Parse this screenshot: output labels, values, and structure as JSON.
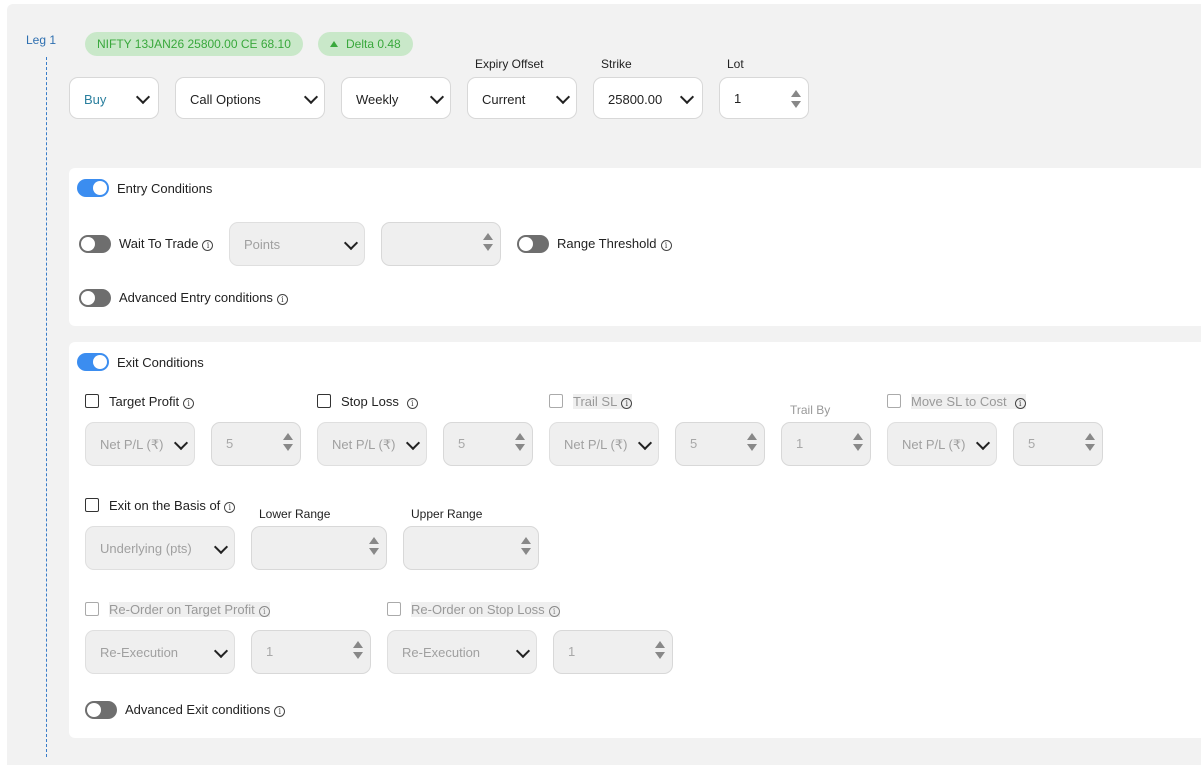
{
  "leg": {
    "label": "Leg 1"
  },
  "pills": {
    "instrument": "NIFTY 13JAN26 25800.00 CE 68.10",
    "delta": "Delta 0.48"
  },
  "top_row": {
    "side": "Buy",
    "option_type": "Call Options",
    "expiry": "Weekly",
    "expiry_offset_label": "Expiry Offset",
    "expiry_offset": "Current",
    "strike_label": "Strike",
    "strike": "25800.00",
    "lot_label": "Lot",
    "lot": "1"
  },
  "entry": {
    "title": "Entry Conditions",
    "wait_to_trade": "Wait To Trade",
    "wait_unit": "Points",
    "wait_value": "",
    "range_threshold": "Range Threshold",
    "advanced": "Advanced Entry conditions"
  },
  "exit": {
    "title": "Exit Conditions",
    "target_profit": {
      "label": "Target Profit",
      "unit": "Net P/L (₹)",
      "value": "5"
    },
    "stop_loss": {
      "label": "Stop Loss",
      "unit": "Net P/L (₹)",
      "value": "5"
    },
    "trail_sl": {
      "label": "Trail SL",
      "unit": "Net P/L (₹)",
      "value": "5",
      "trail_by_label": "Trail By",
      "trail_by": "1"
    },
    "move_sl": {
      "label": "Move SL to Cost",
      "unit": "Net P/L (₹)",
      "value": "5"
    },
    "basis": {
      "label": "Exit on the Basis of",
      "unit": "Underlying (pts)",
      "lower_label": "Lower Range",
      "upper_label": "Upper Range",
      "lower": "",
      "upper": ""
    },
    "reorder_target": {
      "label": "Re-Order on Target Profit",
      "mode": "Re-Execution",
      "value": "1"
    },
    "reorder_stop": {
      "label": "Re-Order on Stop Loss",
      "mode": "Re-Execution",
      "value": "1"
    },
    "advanced": "Advanced Exit conditions"
  },
  "colors": {
    "accent": "#3b8df0",
    "pill_bg": "#c9e8c9",
    "pill_text": "#39a83c",
    "buy_text": "#2a7f9e"
  }
}
